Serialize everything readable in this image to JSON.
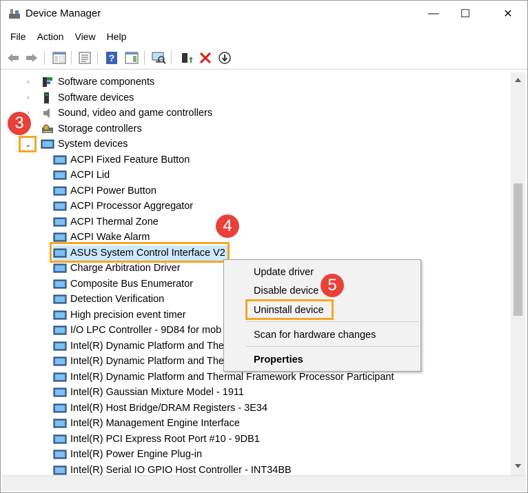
{
  "window": {
    "title": "Device Manager",
    "minimize": "—",
    "maximize": "☐",
    "close": "✕"
  },
  "menu": [
    "File",
    "Action",
    "View",
    "Help"
  ],
  "toolbar": [
    "back-icon",
    "forward-icon",
    "show-hide-console-tree-icon",
    "properties-icon",
    "help-icon",
    "action-pane-icon",
    "scan-hardware-icon",
    "update-driver-icon",
    "uninstall-icon",
    "disable-icon"
  ],
  "tree": [
    {
      "label": "Software components",
      "level": 0,
      "expand": "collapsed",
      "icon": "software-component-icon"
    },
    {
      "label": "Software devices",
      "level": 0,
      "expand": "collapsed",
      "icon": "software-device-icon"
    },
    {
      "label": "Sound, video and game controllers",
      "level": 0,
      "expand": "collapsed",
      "icon": "speaker-icon"
    },
    {
      "label": "Storage controllers",
      "level": 0,
      "expand": "collapsed",
      "icon": "storage-controller-icon"
    },
    {
      "label": "System devices",
      "level": 0,
      "expand": "expanded",
      "icon": "system-device-icon"
    },
    {
      "label": "ACPI Fixed Feature Button",
      "level": 1,
      "icon": "system-device-icon"
    },
    {
      "label": "ACPI Lid",
      "level": 1,
      "icon": "system-device-icon"
    },
    {
      "label": "ACPI Power Button",
      "level": 1,
      "icon": "system-device-icon"
    },
    {
      "label": "ACPI Processor Aggregator",
      "level": 1,
      "icon": "system-device-icon"
    },
    {
      "label": "ACPI Thermal Zone",
      "level": 1,
      "icon": "system-device-icon"
    },
    {
      "label": "ACPI Wake Alarm",
      "level": 1,
      "icon": "system-device-icon"
    },
    {
      "label": "ASUS System Control Interface V2",
      "level": 1,
      "icon": "system-device-icon",
      "selected": true
    },
    {
      "label": "Charge Arbitration Driver",
      "level": 1,
      "icon": "system-device-icon"
    },
    {
      "label": "Composite Bus Enumerator",
      "level": 1,
      "icon": "system-device-icon"
    },
    {
      "label": "Detection Verification",
      "level": 1,
      "icon": "system-device-icon"
    },
    {
      "label": "High precision event timer",
      "level": 1,
      "icon": "system-device-icon"
    },
    {
      "label": "I/O LPC Controller - 9D84 for mob",
      "level": 1,
      "icon": "system-device-icon"
    },
    {
      "label": "Intel(R) Dynamic Platform and The",
      "level": 1,
      "icon": "system-device-icon"
    },
    {
      "label": "Intel(R) Dynamic Platform and The",
      "level": 1,
      "icon": "system-device-icon"
    },
    {
      "label": "Intel(R) Dynamic Platform and Thermal Framework Processor Participant",
      "level": 1,
      "icon": "system-device-icon"
    },
    {
      "label": "Intel(R) Gaussian Mixture Model - 1911",
      "level": 1,
      "icon": "system-device-icon"
    },
    {
      "label": "Intel(R) Host Bridge/DRAM Registers - 3E34",
      "level": 1,
      "icon": "system-device-icon"
    },
    {
      "label": "Intel(R) Management Engine Interface",
      "level": 1,
      "icon": "system-device-icon"
    },
    {
      "label": "Intel(R) PCI Express Root Port #10 - 9DB1",
      "level": 1,
      "icon": "system-device-icon"
    },
    {
      "label": "Intel(R) Power Engine Plug-in",
      "level": 1,
      "icon": "system-device-icon"
    },
    {
      "label": "Intel(R) Serial IO GPIO Host Controller - INT34BB",
      "level": 1,
      "icon": "system-device-icon"
    }
  ],
  "context_menu": {
    "update": "Update driver",
    "disable": "Disable device",
    "uninstall": "Uninstall device",
    "scan": "Scan for hardware changes",
    "properties": "Properties"
  },
  "callouts": {
    "step3": "3",
    "step4": "4",
    "step5": "5"
  },
  "colors": {
    "highlight": "#f5a623",
    "badge": "#e8413a",
    "selection": "#cce8ff"
  }
}
